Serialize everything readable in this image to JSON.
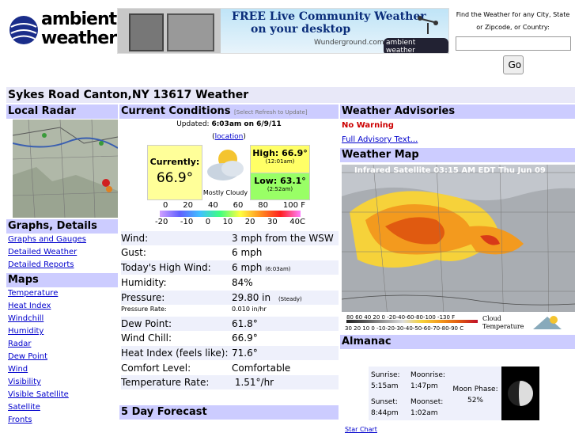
{
  "header": {
    "logo_top": "ambient",
    "logo_bottom": "weather",
    "banner_line1": "FREE Live Community Weather",
    "banner_line2": "on your desktop",
    "banner_sub": "Wunderground.com",
    "banner_brand": "ambient weather"
  },
  "find": {
    "line1": "Find the Weather for any City, State",
    "line2": "or Zipcode, or Country:",
    "input_value": "",
    "go_label": "Go"
  },
  "page_title": "Sykes Road Canton,NY 13617 Weather",
  "left": {
    "radar_header": "Local Radar",
    "graphs_header": "Graphs, Details",
    "graphs_links": [
      "Graphs and Gauges",
      "Detailed Weather",
      "Detailed Reports"
    ],
    "maps_header": "Maps",
    "maps_links": [
      "Temperature",
      "Heat Index",
      "Windchill",
      "Humidity",
      "Radar",
      "Dew Point",
      "Wind",
      "Visibility",
      "Visible Satellite",
      "Satellite",
      "Fronts"
    ]
  },
  "current": {
    "header": "Current Conditions",
    "header_note": "[Select Refresh to Update]",
    "updated_label": "Updated:",
    "updated_value": "6:03am on 6/9/11",
    "location_open": "(",
    "location_link": "location",
    "location_close": ")",
    "currently_label": "Currently:",
    "currently_value": "66.9°",
    "condition": "Mostly Cloudy",
    "high_label": "High: 66.9°",
    "high_time": "(12:01am)",
    "low_label": "Low: 63.1°",
    "low_time": "(2:52am)",
    "scale_f": [
      "0",
      "20",
      "40",
      "60",
      "80",
      "100 F"
    ],
    "scale_c": [
      "-20",
      "-10",
      "0",
      "10",
      "20",
      "30",
      "40C"
    ],
    "rows": [
      {
        "label": "Wind:",
        "value": "3 mph from the WSW"
      },
      {
        "label": "Gust:",
        "value": "6 mph"
      },
      {
        "label": "Today's High Wind:",
        "value": "6 mph",
        "note": "(6:03am)"
      },
      {
        "label": "Humidity:",
        "value": "84%"
      },
      {
        "label": "Pressure:",
        "value": "29.80 in",
        "note": "(Steady)"
      },
      {
        "label": "Pressure Rate:",
        "value": "0.010 in/hr",
        "small": true
      },
      {
        "label": "Dew Point:",
        "value": "61.8°"
      },
      {
        "label": "Wind Chill:",
        "value": "66.9°"
      },
      {
        "label": "Heat Index (feels like):",
        "value": "71.6°"
      },
      {
        "label": "Comfort Level:",
        "value": "Comfortable"
      },
      {
        "label": "Temperature Rate:",
        "value": " 1.51°/hr"
      }
    ]
  },
  "forecast": {
    "header": "5 Day Forecast"
  },
  "advisories": {
    "header": "Weather Advisories",
    "status": "No Warning",
    "link": "Full Advisory Text..."
  },
  "weather_map": {
    "header": "Weather Map",
    "caption": "Infrared Satellite 03:15 AM EDT Thu Jun 09",
    "scale_top": "80 60 40 20 0 -20-40-60-80-100 -130 F",
    "scale_bottom": "30 20 10 0 -10-20-30-40-50-60-70-80-90 C",
    "legend1": "Cloud",
    "legend2": "Temperature"
  },
  "almanac": {
    "header": "Almanac",
    "sunrise_label": "Sunrise:",
    "sunrise": "5:15am",
    "sunset_label": "Sunset:",
    "sunset": "8:44pm",
    "moonrise_label": "Moonrise:",
    "moonrise": "1:47pm",
    "moonset_label": "Moonset:",
    "moonset": "1:02am",
    "moon_phase_label": "Moon Phase:",
    "moon_phase": "52%",
    "star_chart": "Star Chart"
  },
  "colors": {
    "header_bg": "#ccccff",
    "link": "#0000cc",
    "warning": "#cc0000"
  }
}
